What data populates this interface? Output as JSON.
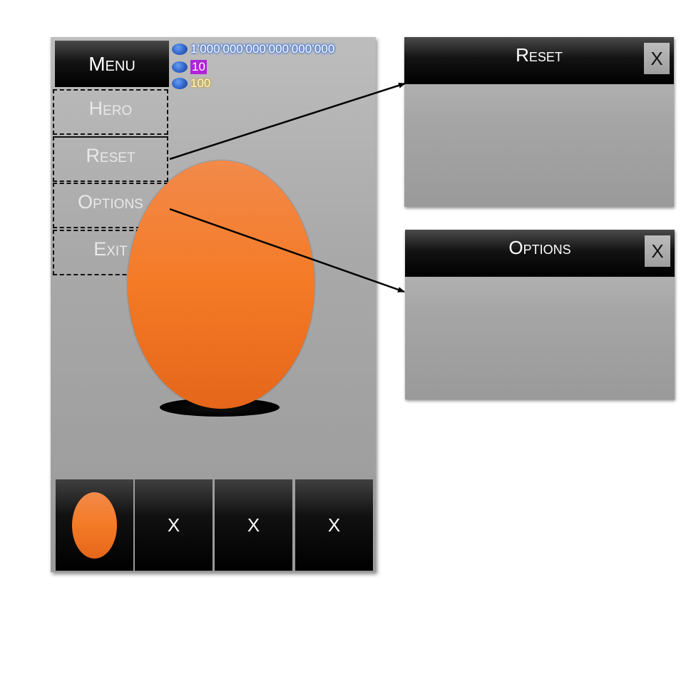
{
  "menu": {
    "button_label": "Menu",
    "items": [
      {
        "label": "Hero"
      },
      {
        "label": "Reset"
      },
      {
        "label": "Options"
      },
      {
        "label": "Exit"
      }
    ]
  },
  "currencies": [
    {
      "value": "1’000’000’000’000’000’000",
      "color": "#3a6fd8"
    },
    {
      "value": "10",
      "color": "#b024d8"
    },
    {
      "value": "100",
      "color": "#c9a11a"
    }
  ],
  "slots": [
    {
      "icon": "egg-icon"
    },
    {
      "label": "X"
    },
    {
      "label": "X"
    },
    {
      "label": "X"
    }
  ],
  "panels": {
    "reset": {
      "title": "Reset",
      "close_label": "X"
    },
    "options": {
      "title": "Options",
      "close_label": "X"
    }
  },
  "colors": {
    "egg": "#f47a26",
    "header": "#000000",
    "background": "#a9a9a9"
  }
}
